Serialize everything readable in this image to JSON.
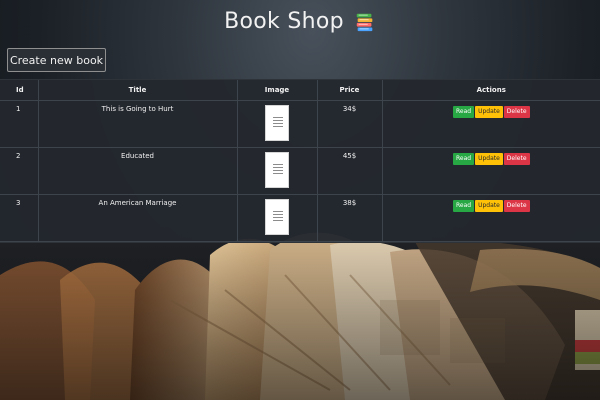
{
  "header": {
    "title": "Book Shop",
    "icon": "books-icon"
  },
  "toolbar": {
    "create_label": "Create new book"
  },
  "table": {
    "columns": [
      "Id",
      "Title",
      "Image",
      "Price",
      "Actions"
    ],
    "rows": [
      {
        "id": "1",
        "title": "This is Going to Hurt",
        "price": "34$"
      },
      {
        "id": "2",
        "title": "Educated",
        "price": "45$"
      },
      {
        "id": "3",
        "title": "An American Marriage",
        "price": "38$"
      }
    ],
    "action_labels": {
      "read": "Read",
      "update": "Update",
      "delete": "Delete"
    }
  },
  "colors": {
    "read": "#28a745",
    "update": "#ffc107",
    "delete": "#dc3545"
  }
}
